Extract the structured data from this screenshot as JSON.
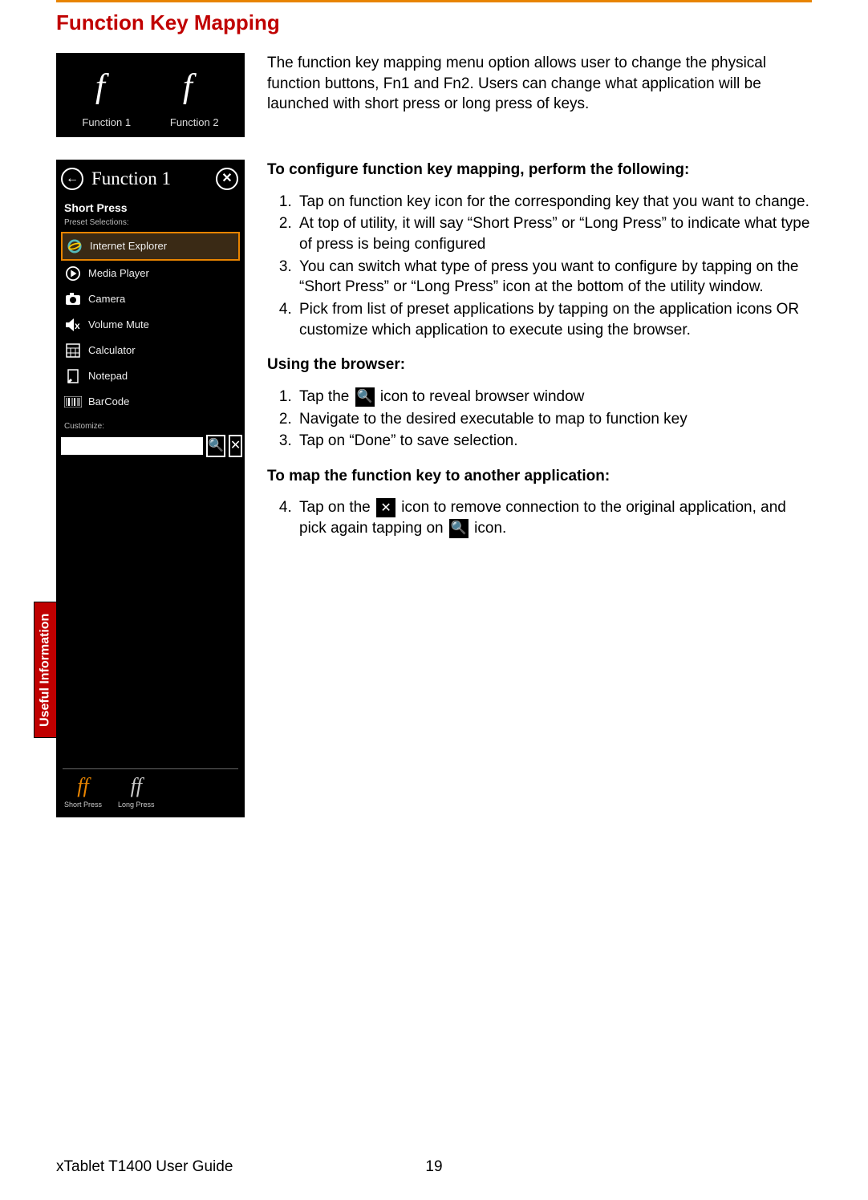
{
  "top_rule": true,
  "section_title": "Function Key Mapping",
  "intro_paragraph": "The function key mapping menu option allows user to change the physical function buttons, Fn1 and Fn2. Users can change what application will be launched with short press or long press of keys.",
  "key_tiles": [
    {
      "label": "Function 1"
    },
    {
      "label": "Function 2"
    }
  ],
  "phone": {
    "title": "Function 1",
    "section_label": "Short Press",
    "preset_label": "Preset Selections:",
    "presets": [
      {
        "name": "Internet Explorer",
        "selected": true,
        "icon": "ie"
      },
      {
        "name": "Media Player",
        "selected": false,
        "icon": "play"
      },
      {
        "name": "Camera",
        "selected": false,
        "icon": "camera"
      },
      {
        "name": "Volume Mute",
        "selected": false,
        "icon": "mute"
      },
      {
        "name": "Calculator",
        "selected": false,
        "icon": "calc"
      },
      {
        "name": "Notepad",
        "selected": false,
        "icon": "note"
      },
      {
        "name": "BarCode",
        "selected": false,
        "icon": "barcode"
      }
    ],
    "customize_label": "Customize:",
    "bottom": [
      {
        "label": "Short Press",
        "active": true
      },
      {
        "label": "Long Press",
        "active": false
      }
    ]
  },
  "doc": {
    "heading1": "To configure function key mapping, perform the following:",
    "list1": [
      "Tap on function key icon for the corresponding key that you want to change.",
      "At top of utility, it will say “Short Press” or “Long Press” to indicate what type of press is being configured",
      "You can switch what type of press you want to configure by tapping on the “Short Press” or “Long Press” icon at the bottom of the utility window.",
      "Pick from list of preset applications by tapping on the application icons OR customize which application to execute using the browser."
    ],
    "heading2": "Using the browser:",
    "list2": [
      {
        "pre": "Tap the ",
        "icon": "search",
        "post": " icon to reveal browser window"
      },
      {
        "text": "Navigate to the desired executable to map to function key"
      },
      {
        "text": "Tap on “Done” to save selection."
      }
    ],
    "heading3": "To map the function key to another application:",
    "list3_item_pre": " Tap on the ",
    "list3_item_mid": " icon to remove connection to the original application, and pick again tapping on ",
    "list3_item_post": " icon."
  },
  "side_tab": "Useful Information",
  "footer_left": "xTablet T1400 User Guide",
  "footer_page": "19"
}
